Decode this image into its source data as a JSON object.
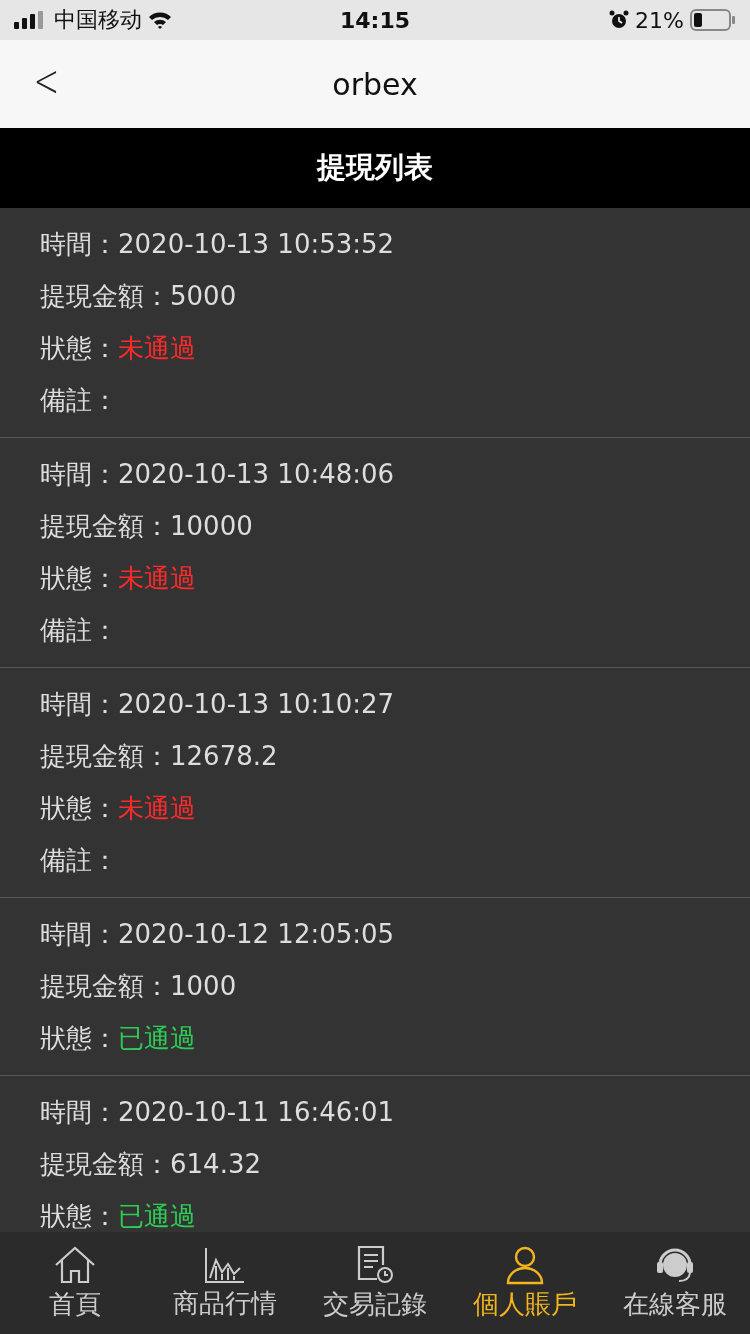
{
  "status_bar": {
    "carrier": "中国移动",
    "time": "14:15",
    "battery": "21%"
  },
  "header": {
    "back": "<",
    "title": "orbex"
  },
  "section_title": "提現列表",
  "records": [
    {
      "lines": [
        {
          "label": "時間：",
          "value": "2020-10-13 10:53:52"
        },
        {
          "label": "提現金額：",
          "value": "5000"
        },
        {
          "label": "狀態：",
          "value": "未通過",
          "color": "#ff2a2a"
        },
        {
          "label": "備註："
        }
      ]
    },
    {
      "lines": [
        {
          "label": "時間：",
          "value": "2020-10-13 10:48:06"
        },
        {
          "label": "提現金額：",
          "value": "10000"
        },
        {
          "label": "狀態：",
          "value": "未通過",
          "color": "#ff2a2a"
        },
        {
          "label": "備註："
        }
      ]
    },
    {
      "lines": [
        {
          "label": "時間：",
          "value": "2020-10-13 10:10:27"
        },
        {
          "label": "提現金額：",
          "value": "12678.2"
        },
        {
          "label": "狀態：",
          "value": "未通過",
          "color": "#ff2a2a"
        },
        {
          "label": "備註："
        }
      ]
    },
    {
      "lines": [
        {
          "label": "時間：",
          "value": "2020-10-12 12:05:05"
        },
        {
          "label": "提現金額：",
          "value": "1000"
        },
        {
          "label": "狀態：",
          "value": "已通過",
          "color": "#2ecc55"
        }
      ]
    },
    {
      "lines": [
        {
          "label": "時間：",
          "value": "2020-10-11 16:46:01"
        },
        {
          "label": "提現金額：",
          "value": "614.32"
        },
        {
          "label": "狀態：",
          "value": "已通過",
          "color": "#2ecc55"
        }
      ]
    }
  ],
  "tab_bar": [
    {
      "kind": "home",
      "label": "首頁",
      "selected": false
    },
    {
      "kind": "chart",
      "label": "商品行情",
      "selected": false
    },
    {
      "kind": "record",
      "label": "交易記錄",
      "selected": false
    },
    {
      "kind": "account",
      "label": "個人賬戶",
      "selected": true
    },
    {
      "kind": "support",
      "label": "在線客服",
      "selected": false
    }
  ]
}
